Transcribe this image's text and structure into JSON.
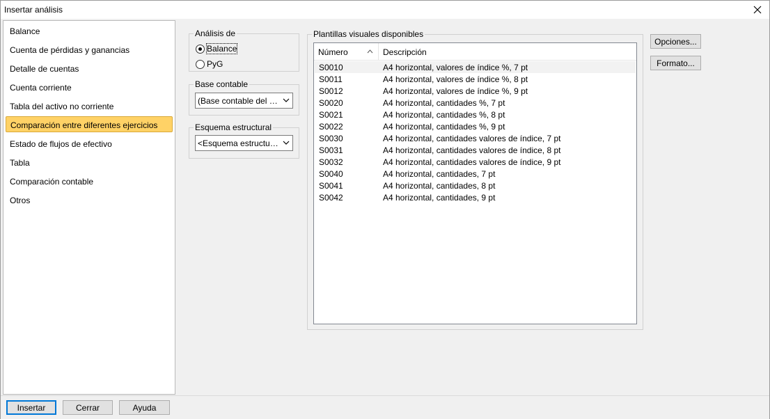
{
  "window": {
    "title": "Insertar análisis"
  },
  "nav": {
    "items": [
      {
        "label": "Balance",
        "selected": false
      },
      {
        "label": "Cuenta de pérdidas y ganancias",
        "selected": false
      },
      {
        "label": "Detalle de cuentas",
        "selected": false
      },
      {
        "label": "Cuenta corriente",
        "selected": false
      },
      {
        "label": "Tabla del activo no corriente",
        "selected": false
      },
      {
        "label": "Comparación entre diferentes ejercicios",
        "selected": true
      },
      {
        "label": "Estado de flujos de efectivo",
        "selected": false
      },
      {
        "label": "Tabla",
        "selected": false
      },
      {
        "label": "Comparación contable",
        "selected": false
      },
      {
        "label": "Otros",
        "selected": false
      }
    ]
  },
  "analysis_group": {
    "label": "Análisis de",
    "options": [
      {
        "label": "Balance",
        "checked": true
      },
      {
        "label": "PyG",
        "checked": false
      }
    ]
  },
  "base_group": {
    "label": "Base contable",
    "value": "(Base contable del documento)"
  },
  "scheme_group": {
    "label": "Esquema estructural",
    "value": "<Esquema estructural estándar>"
  },
  "templates": {
    "label": "Plantillas visuales disponibles",
    "columns": [
      "Número",
      "Descripción"
    ],
    "rows": [
      {
        "num": "S0010",
        "desc": "A4 horizontal, valores de índice %, 7 pt"
      },
      {
        "num": "S0011",
        "desc": "A4 horizontal, valores de índice %, 8 pt"
      },
      {
        "num": "S0012",
        "desc": "A4 horizontal, valores de índice %, 9 pt"
      },
      {
        "num": "S0020",
        "desc": "A4 horizontal, cantidades %, 7 pt"
      },
      {
        "num": "S0021",
        "desc": "A4 horizontal, cantidades %, 8 pt"
      },
      {
        "num": "S0022",
        "desc": "A4 horizontal, cantidades %, 9 pt"
      },
      {
        "num": "S0030",
        "desc": "A4 horizontal, cantidades valores de índice, 7 pt"
      },
      {
        "num": "S0031",
        "desc": "A4 horizontal, cantidades valores de índice, 8 pt"
      },
      {
        "num": "S0032",
        "desc": "A4 horizontal, cantidades valores de índice, 9 pt"
      },
      {
        "num": "S0040",
        "desc": "A4 horizontal, cantidades, 7 pt"
      },
      {
        "num": "S0041",
        "desc": "A4 horizontal, cantidades, 8 pt"
      },
      {
        "num": "S0042",
        "desc": "A4 horizontal, cantidades, 9 pt"
      }
    ]
  },
  "side_buttons": {
    "options": "Opciones...",
    "format": "Formato..."
  },
  "footer": {
    "insert": "Insertar",
    "close": "Cerrar",
    "help": "Ayuda"
  },
  "colors": {
    "selection": "#ffd266",
    "default_button_border": "#0078d7"
  }
}
